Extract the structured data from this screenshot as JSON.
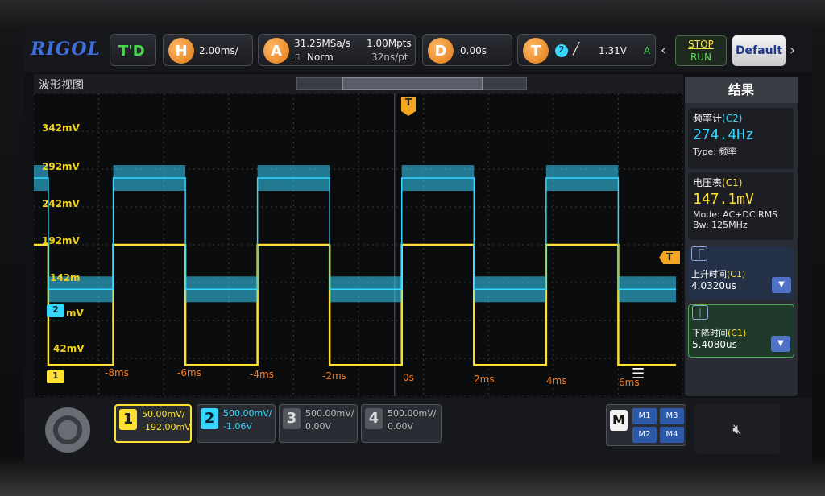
{
  "brand": "RIGOL",
  "trigger_mode": "T'D",
  "horizontal": {
    "key": "H",
    "timebase": "2.00ms/"
  },
  "acquire": {
    "key": "A",
    "sample_rate": "31.25MSa/s",
    "mode": "Norm",
    "memory": "1.00Mpts",
    "per_point": "32ns/pt"
  },
  "delay": {
    "key": "D",
    "value": "0.00s"
  },
  "trigger": {
    "key": "T",
    "source": "2",
    "level": "1.31V",
    "coupling": "A"
  },
  "run": {
    "stop": "STOP",
    "run": "RUN"
  },
  "default_label": "Default",
  "waveform_title": "波形视图",
  "trigger_marker": "T",
  "results_title": "结果",
  "freq_counter": {
    "title": "频率计",
    "channel": "(C2)",
    "value": "274.4Hz",
    "type_label": "Type:",
    "type_value": "频率"
  },
  "voltmeter": {
    "title": "电压表",
    "channel": "(C1)",
    "value": "147.1mV",
    "mode": "Mode: AC+DC RMS",
    "bw": "Bw:",
    "bw_value": "125MHz"
  },
  "rise_time": {
    "label": "上升时间",
    "channel": "(C1)",
    "value": "4.0320us"
  },
  "fall_time": {
    "label": "下降时间",
    "channel": "(C1)",
    "value": "5.4080us"
  },
  "channels": [
    {
      "num": "1",
      "scale": "50.00mV/",
      "offset": "-192.00mV",
      "color": "#ffe033"
    },
    {
      "num": "2",
      "scale": "500.00mV/",
      "offset": "-1.06V",
      "color": "#35d6ff"
    },
    {
      "num": "3",
      "scale": "500.00mV/",
      "offset": "0.00V",
      "color": "#bdbdbd"
    },
    {
      "num": "4",
      "scale": "500.00mV/",
      "offset": "0.00V",
      "color": "#bdbdbd"
    }
  ],
  "math_key": "M",
  "math": [
    "M1",
    "M3",
    "M2",
    "M4"
  ],
  "y_labels": [
    "342mV",
    "292mV",
    "242mV",
    "192mV",
    "142m",
    "2",
    "mV",
    "42mV"
  ],
  "x_labels": [
    "-8ms",
    "-6ms",
    "-4ms",
    "-2ms",
    "0s",
    "2ms",
    "4ms",
    "6ms"
  ],
  "ch_marker_1": "1",
  "ch_marker_2": "2",
  "trig_level_marker": "T",
  "chart_data": {
    "type": "line",
    "series": [
      {
        "name": "C1",
        "color": "#ffe033",
        "x": [
          -10,
          -9.6,
          -9.6,
          -7.8,
          -7.8,
          -5.8,
          -5.8,
          -3.8,
          -3.8,
          -1.8,
          -1.8,
          0.2,
          0.2,
          2.2,
          2.2,
          4.2,
          4.2,
          6.2,
          6.2,
          7.8
        ],
        "y": [
          192,
          192,
          57,
          57,
          192,
          192,
          57,
          57,
          192,
          192,
          57,
          57,
          192,
          192,
          57,
          57,
          192,
          192,
          57,
          57
        ]
      },
      {
        "name": "C2",
        "color": "#35d6ff",
        "x": [
          -10,
          -9.6,
          -9.6,
          -7.8,
          -7.8,
          -5.8,
          -5.8,
          -3.8,
          -3.8,
          -1.8,
          -1.8,
          0.2,
          0.2,
          2.2,
          2.2,
          4.2,
          4.2,
          6.2,
          6.2,
          7.8
        ],
        "y": [
          267,
          267,
          142,
          142,
          267,
          267,
          142,
          142,
          267,
          267,
          142,
          142,
          267,
          267,
          142,
          142,
          267,
          267,
          142,
          142
        ]
      }
    ],
    "xlim": [
      -10,
      8
    ],
    "ylim": [
      22,
      362
    ],
    "grid": true
  }
}
